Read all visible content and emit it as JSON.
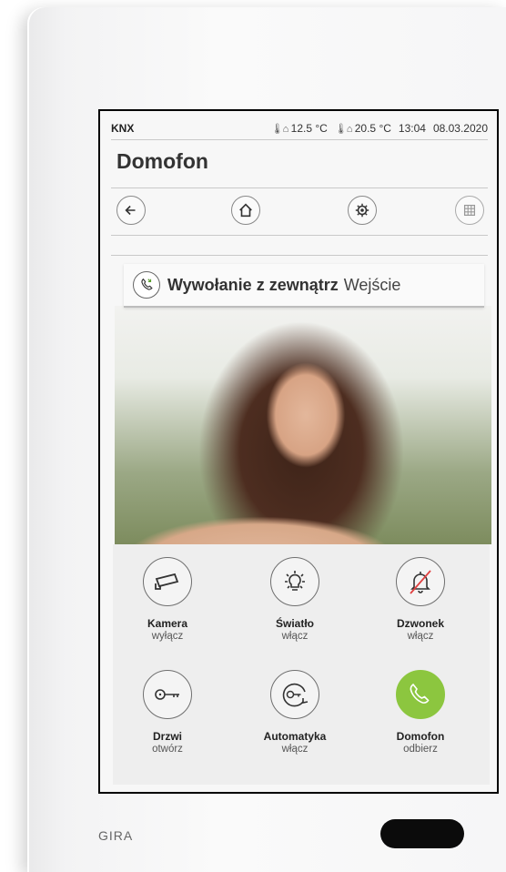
{
  "status": {
    "brand": "KNX",
    "temp_outdoor": "12.5 °C",
    "temp_indoor": "20.5 °C",
    "time": "13:04",
    "date": "08.03.2020"
  },
  "page_title": "Domofon",
  "nav": {
    "back_icon": "arrow-left-icon",
    "home_icon": "home-icon",
    "settings_icon": "settings-gear-icon",
    "grid_icon": "grid-icon"
  },
  "call_banner": {
    "icon": "phone-incoming-icon",
    "title": "Wywołanie z zewnątrz",
    "location": "Wejście"
  },
  "controls": [
    {
      "icon": "camera-icon",
      "label": "Kamera",
      "sub": "wyłącz"
    },
    {
      "icon": "light-bulb-icon",
      "label": "Światło",
      "sub": "włącz"
    },
    {
      "icon": "bell-muted-icon",
      "label": "Dzwonek",
      "sub": "włącz"
    },
    {
      "icon": "key-icon",
      "label": "Drzwi",
      "sub": "otwórz"
    },
    {
      "icon": "auto-key-icon",
      "label": "Automatyka",
      "sub": "włącz"
    },
    {
      "icon": "phone-answer-icon",
      "label": "Domofon",
      "sub": "odbierz"
    }
  ],
  "device_brand": "GIRA",
  "colors": {
    "answer_green": "#8cc63f",
    "mute_red": "#e04040"
  }
}
